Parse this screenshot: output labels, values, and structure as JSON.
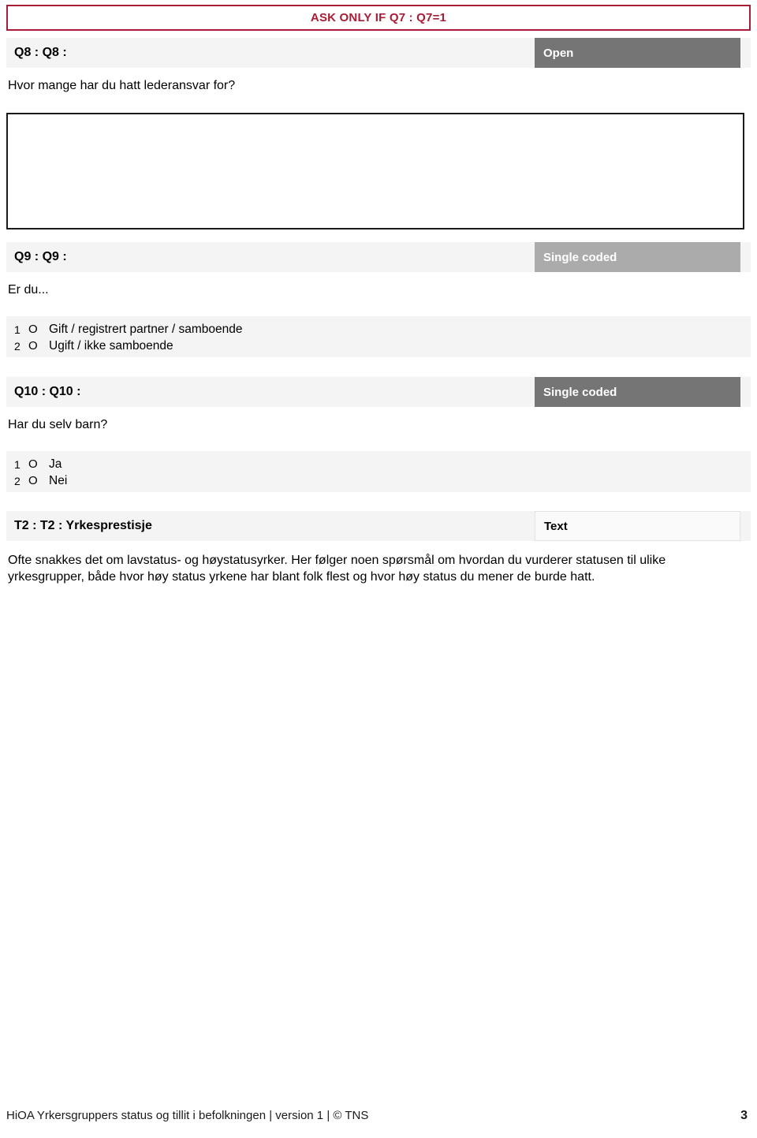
{
  "document": {
    "routing_banner": "ASK ONLY IF Q7 : Q7=1",
    "accent_red": "#A81C35",
    "badge_dark": "#757575",
    "badge_mid": "#ABABAB",
    "band_gray": "#F4F4F4"
  },
  "questions": [
    {
      "id": "Q8",
      "header_label": "Q8 : Q8 :",
      "type_badge": "Open",
      "badge_style": "dark",
      "text": "Hvor mange har du hatt lederansvar for?",
      "response_kind": "open-text-box",
      "options": []
    },
    {
      "id": "Q9",
      "header_label": "Q9 : Q9 :",
      "type_badge": "Single coded",
      "badge_style": "mid",
      "text": "Er du...",
      "response_kind": "single-coded-list",
      "options": [
        {
          "code": "1",
          "radio": "O",
          "label": "Gift / registrert partner / samboende"
        },
        {
          "code": "2",
          "radio": "O",
          "label": "Ugift / ikke samboende"
        }
      ]
    },
    {
      "id": "Q10",
      "header_label": "Q10 : Q10 :",
      "type_badge": "Single coded",
      "badge_style": "dark",
      "text": "Har du selv barn?",
      "response_kind": "single-coded-list",
      "options": [
        {
          "code": "1",
          "radio": "O",
          "label": "Ja"
        },
        {
          "code": "2",
          "radio": "O",
          "label": "Nei"
        }
      ]
    }
  ],
  "text_block": {
    "header_label": "T2 : T2 : Yrkesprestisje",
    "type_badge": "Text",
    "badge_style": "light",
    "body": "Ofte snakkes det om lavstatus- og høystatusyrker. Her følger noen spørsmål om hvordan du vurderer statusen til ulike yrkesgrupper, både hvor høy status yrkene har blant folk flest og hvor høy status du mener de burde hatt."
  },
  "footer": {
    "left": "HiOA Yrkersgruppers status og tillit i befolkningen | version 1 | © TNS",
    "page_number": "3"
  }
}
